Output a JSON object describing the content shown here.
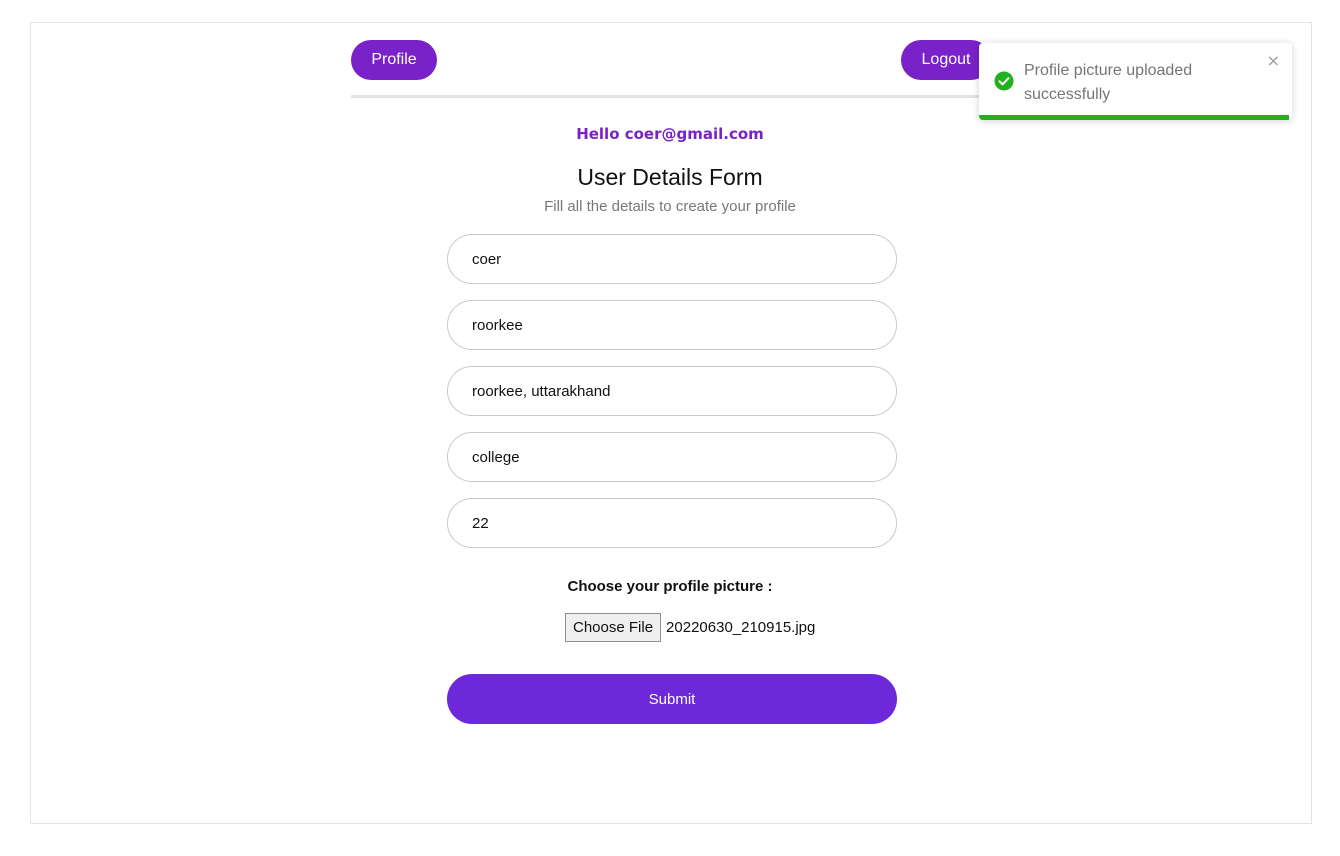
{
  "header": {
    "profile_label": "Profile",
    "logout_label": "Logout"
  },
  "greeting": "Hello coer@gmail.com",
  "form": {
    "title": "User Details Form",
    "subtitle": "Fill all the details to create your profile",
    "fields": [
      {
        "value": "coer"
      },
      {
        "value": "roorkee"
      },
      {
        "value": "roorkee, uttarakhand"
      },
      {
        "value": "college"
      },
      {
        "value": "22"
      }
    ],
    "file_label": "Choose your profile picture :",
    "choose_file_label": "Choose File",
    "file_name": "20220630_210915.jpg",
    "submit_label": "Submit"
  },
  "toast": {
    "message": "Profile picture uploaded successfully",
    "close_glyph": "×",
    "icon": "check-circle-icon",
    "progress": 0.99
  },
  "colors": {
    "accent": "#7a22c9",
    "submit": "#6d28d9",
    "success": "#22b11e"
  }
}
